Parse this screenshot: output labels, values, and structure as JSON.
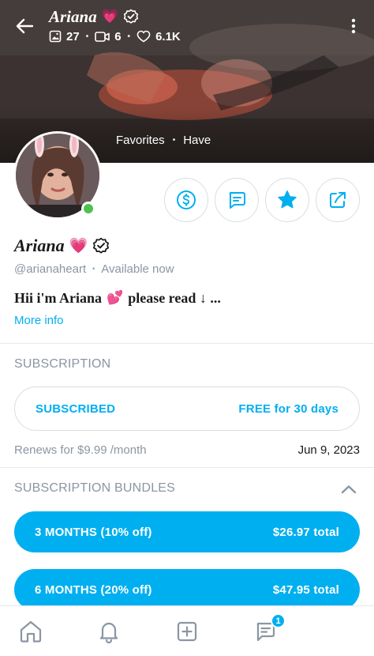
{
  "header": {
    "name": "Ariana",
    "name_emoji": "💗",
    "photos_count": "27",
    "videos_count": "6",
    "likes_count": "6.1K",
    "cover_tabs": [
      "Favorites",
      "Have"
    ]
  },
  "profile": {
    "name": "Ariana",
    "name_emoji": "💗",
    "handle": "@arianaheart",
    "status": "Available now",
    "bio": "Hii i'm Ariana",
    "bio_emoji": "💕",
    "bio_rest": "please read ↓ ...",
    "more_info": "More info"
  },
  "actions": [
    {
      "icon": "dollar-icon"
    },
    {
      "icon": "message-icon"
    },
    {
      "icon": "star-icon"
    },
    {
      "icon": "share-icon"
    }
  ],
  "subscription": {
    "title": "SUBSCRIPTION",
    "status_label": "SUBSCRIBED",
    "offer_label": "FREE for 30 days",
    "renew_text": "Renews for $9.99 /month",
    "renew_date": "Jun 9, 2023"
  },
  "bundles": {
    "title": "SUBSCRIPTION BUNDLES",
    "items": [
      {
        "label": "3 MONTHS (10% off)",
        "price": "$26.97 total"
      },
      {
        "label": "6 MONTHS (20% off)",
        "price": "$47.95 total"
      }
    ]
  },
  "nav": {
    "items": [
      {
        "icon": "home-icon"
      },
      {
        "icon": "bell-icon"
      },
      {
        "icon": "add-post-icon"
      },
      {
        "icon": "messages-icon"
      }
    ],
    "messages_badge": "1"
  },
  "colors": {
    "accent": "#00aff0",
    "muted": "#8a96a3",
    "online": "#4ec24f"
  }
}
